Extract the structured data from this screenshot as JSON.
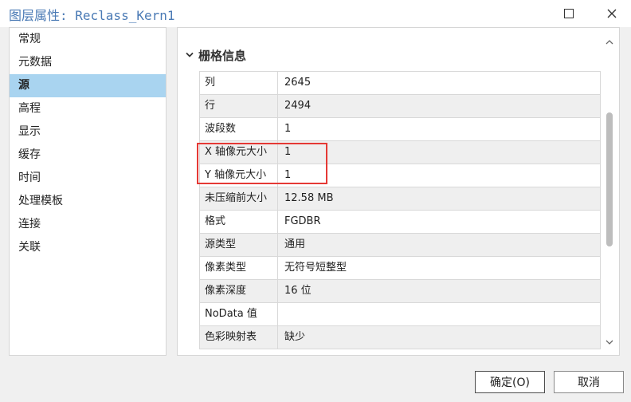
{
  "window": {
    "title": "图层属性: Reclass_Kern1"
  },
  "sidebar": {
    "items": [
      {
        "label": "常规",
        "active": false
      },
      {
        "label": "元数据",
        "active": false
      },
      {
        "label": "源",
        "active": true
      },
      {
        "label": "高程",
        "active": false
      },
      {
        "label": "显示",
        "active": false
      },
      {
        "label": "缓存",
        "active": false
      },
      {
        "label": "时间",
        "active": false
      },
      {
        "label": "处理模板",
        "active": false
      },
      {
        "label": "连接",
        "active": false
      },
      {
        "label": "关联",
        "active": false
      }
    ]
  },
  "section": {
    "title": "栅格信息",
    "rows": [
      {
        "key": "列",
        "value": "2645"
      },
      {
        "key": "行",
        "value": "2494"
      },
      {
        "key": "波段数",
        "value": "1"
      },
      {
        "key": "X 轴像元大小",
        "value": "1"
      },
      {
        "key": "Y 轴像元大小",
        "value": "1"
      },
      {
        "key": "未压缩前大小",
        "value": "12.58 MB"
      },
      {
        "key": "格式",
        "value": "FGDBR"
      },
      {
        "key": "源类型",
        "value": "通用"
      },
      {
        "key": "像素类型",
        "value": "无符号短整型"
      },
      {
        "key": "像素深度",
        "value": "16 位"
      },
      {
        "key": "NoData 值",
        "value": ""
      },
      {
        "key": "色彩映射表",
        "value": "缺少"
      }
    ]
  },
  "buttons": {
    "ok": "确定(O)",
    "cancel": "取消"
  },
  "colors": {
    "title": "#4a7ab5",
    "active_item": "#a9d4f0",
    "highlight": "#e53935"
  }
}
